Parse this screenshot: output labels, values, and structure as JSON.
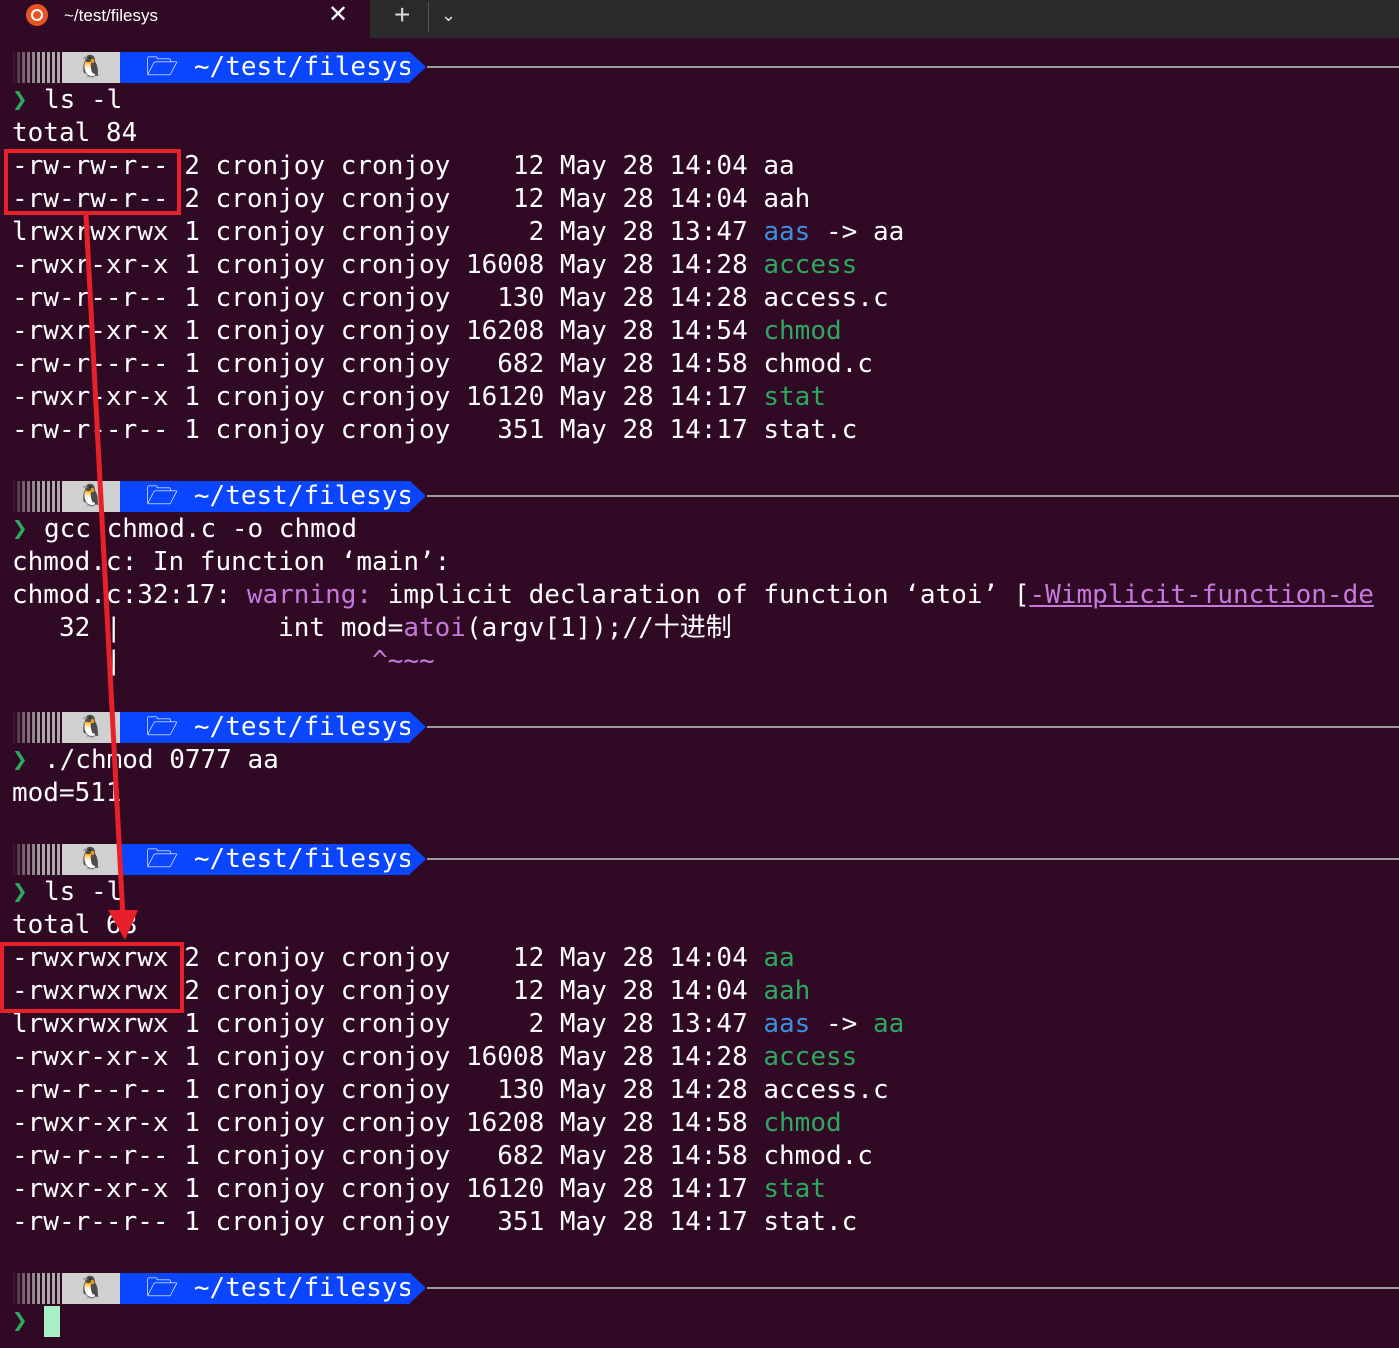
{
  "tab": {
    "title": "~/test/filesys",
    "close": "✕",
    "new_tab": "+",
    "menu": "⌄"
  },
  "prompt": {
    "user_glyph": "🐧",
    "path": "🗁 ~/test/filesys",
    "caret": "❯"
  },
  "block1": {
    "cmd": "ls -l",
    "total": "total 84",
    "rows": [
      {
        "perm": "-rw-rw-r--",
        "rest": " 2 cronjoy cronjoy    12 May 28 14:04 ",
        "name": "aa",
        "cls": "",
        "link": ""
      },
      {
        "perm": "-rw-rw-r--",
        "rest": " 2 cronjoy cronjoy    12 May 28 14:04 ",
        "name": "aah",
        "cls": "",
        "link": ""
      },
      {
        "perm": "lrwxrwxrwx",
        "rest": " 1 cronjoy cronjoy     2 May 28 13:47 ",
        "name": "aas",
        "cls": "blue",
        "link": " -> aa"
      },
      {
        "perm": "-rwxr-xr-x",
        "rest": " 1 cronjoy cronjoy 16008 May 28 14:28 ",
        "name": "access",
        "cls": "green",
        "link": ""
      },
      {
        "perm": "-rw-r--r--",
        "rest": " 1 cronjoy cronjoy   130 May 28 14:28 ",
        "name": "access.c",
        "cls": "",
        "link": ""
      },
      {
        "perm": "-rwxr-xr-x",
        "rest": " 1 cronjoy cronjoy 16208 May 28 14:54 ",
        "name": "chmod",
        "cls": "green",
        "link": ""
      },
      {
        "perm": "-rw-r--r--",
        "rest": " 1 cronjoy cronjoy   682 May 28 14:58 ",
        "name": "chmod.c",
        "cls": "",
        "link": ""
      },
      {
        "perm": "-rwxr-xr-x",
        "rest": " 1 cronjoy cronjoy 16120 May 28 14:17 ",
        "name": "stat",
        "cls": "green",
        "link": ""
      },
      {
        "perm": "-rw-r--r--",
        "rest": " 1 cronjoy cronjoy   351 May 28 14:17 ",
        "name": "stat.c",
        "cls": "",
        "link": ""
      }
    ]
  },
  "block2": {
    "cmd": "gcc chmod.c -o chmod",
    "line1": "chmod.c: In function ‘main’:",
    "line2_pre": "chmod.c:32:17: ",
    "line2_warn": "warning:",
    "line2_mid": " implicit declaration of function ‘atoi’ [",
    "line2_flag": "-Wimplicit-function-de",
    "line3_pre": "   32 |          int mod=",
    "line3_fn": "atoi",
    "line3_post": "(argv[1]);//十进制",
    "line4_pre": "      |",
    "line4_squiggle": "                ^~~~"
  },
  "block3": {
    "cmd": "./chmod 0777 aa",
    "out": "mod=511"
  },
  "block4": {
    "cmd": "ls -l",
    "total": "total 68",
    "rows": [
      {
        "perm": "-rwxrwxrwx",
        "rest": " 2 cronjoy cronjoy    12 May 28 14:04 ",
        "name": "aa",
        "cls": "green",
        "link": ""
      },
      {
        "perm": "-rwxrwxrwx",
        "rest": " 2 cronjoy cronjoy    12 May 28 14:04 ",
        "name": "aah",
        "cls": "green",
        "link": ""
      },
      {
        "perm": "lrwxrwxrwx",
        "rest": " 1 cronjoy cronjoy     2 May 28 13:47 ",
        "name": "aas",
        "cls": "blue",
        "link": " -> aa",
        "link_green": true
      },
      {
        "perm": "-rwxr-xr-x",
        "rest": " 1 cronjoy cronjoy 16008 May 28 14:28 ",
        "name": "access",
        "cls": "green",
        "link": ""
      },
      {
        "perm": "-rw-r--r--",
        "rest": " 1 cronjoy cronjoy   130 May 28 14:28 ",
        "name": "access.c",
        "cls": "",
        "link": ""
      },
      {
        "perm": "-rwxr-xr-x",
        "rest": " 1 cronjoy cronjoy 16208 May 28 14:58 ",
        "name": "chmod",
        "cls": "green",
        "link": ""
      },
      {
        "perm": "-rw-r--r--",
        "rest": " 1 cronjoy cronjoy   682 May 28 14:58 ",
        "name": "chmod.c",
        "cls": "",
        "link": ""
      },
      {
        "perm": "-rwxr-xr-x",
        "rest": " 1 cronjoy cronjoy 16120 May 28 14:17 ",
        "name": "stat",
        "cls": "green",
        "link": ""
      },
      {
        "perm": "-rw-r--r--",
        "rest": " 1 cronjoy cronjoy   351 May 28 14:17 ",
        "name": "stat.c",
        "cls": "",
        "link": ""
      }
    ]
  },
  "colors": {
    "background": "#300a24",
    "exec": "#2ea860",
    "link": "#3b8ee0",
    "warning": "#c678dd",
    "annotation": "#e8202a",
    "path_segment": "#0a46ff"
  }
}
